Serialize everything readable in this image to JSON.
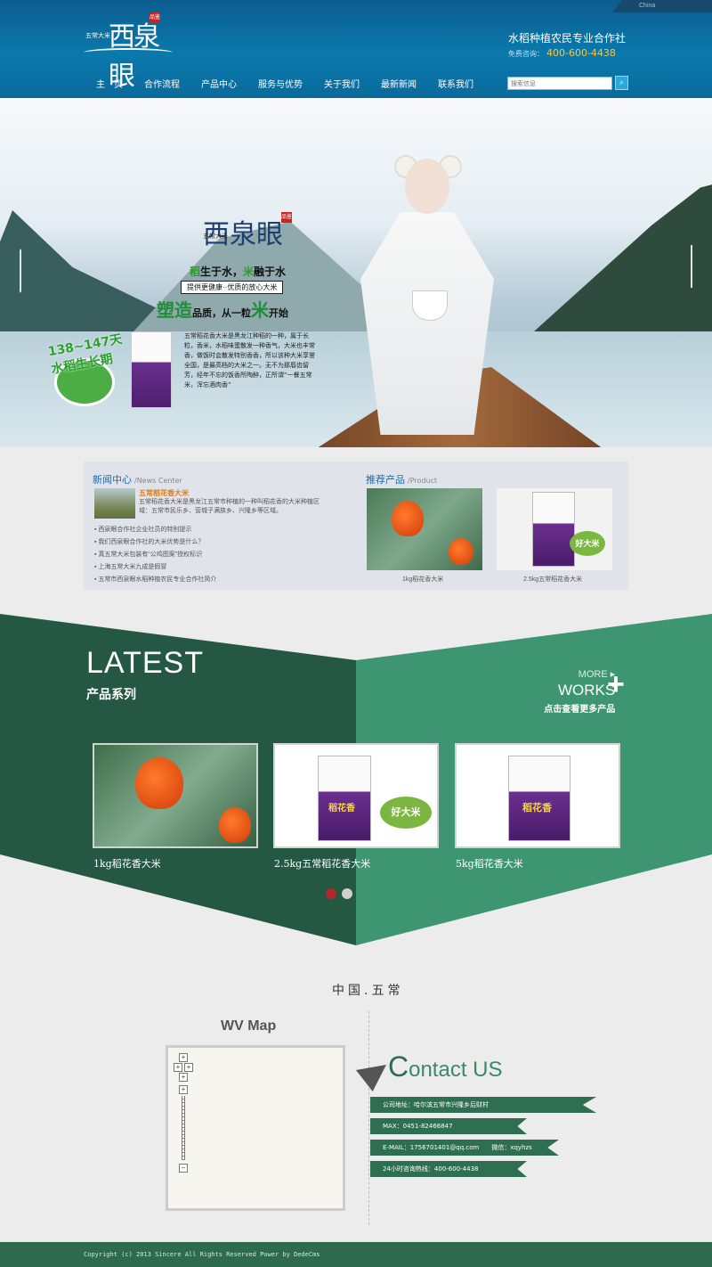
{
  "header": {
    "china_tag": "China",
    "logo_small": "五常大米",
    "logo_main": "西泉眼",
    "logo_seal": "品鉴",
    "coop_name": "水稻种植农民专业合作社",
    "hotline_label": "免费咨询：",
    "hotline_number": "400-600-4438",
    "nav": [
      "主　页",
      "合作流程",
      "产品中心",
      "服务与优势",
      "关于我们",
      "最新新闻",
      "联系我们"
    ],
    "search_placeholder": "搜索信息"
  },
  "banner": {
    "logo_small": "五常大米",
    "logo_main": "西泉眼",
    "logo_seal": "品鉴",
    "slogan1_a": "稻",
    "slogan1_b": "生于水，",
    "slogan1_c": "米",
    "slogan1_d": "融于水",
    "slogan2": "提供更健康··优质的放心大米",
    "slogan3_a": "塑造",
    "slogan3_b": "品质，从一粒",
    "slogan3_c": "米",
    "slogan3_d": "开始",
    "description": "五常稻花香大米是黑龙江种稻的一种，属于长粒，香米，水稻味蛋散发一种香气，大米也丰常香，做饭时会散发特别香香，所以该种大米享誉全国，是最高档的大米之一。无不为那唇齿留芳，经年不忘的饭香所陶醉，正所谓“一餐五常米，浑忘酒肉香”",
    "badge_text": "138~147天水稻生长期"
  },
  "news": {
    "title": "新闻中心",
    "title_en": "/News Center",
    "featured_title": "五常稻花香大米",
    "featured_desc": "五常稻花香大米是黑龙江五常市种植的一种叫稻花香的大米种植区域：五常市民乐乡、营城子满族乡、兴隆乡等区域。",
    "items": [
      "西泉眼合作社企业社员的特别提示",
      "我们西泉眼合作社的大米优势是什么？",
      "真五常大米包装有“公鸡图案”授权标识",
      "上海五常大米九成是假冒",
      "五常市西泉眼水稻种植农民专业合作社简介"
    ]
  },
  "recommend": {
    "title": "推荐产品",
    "title_en": "/Product",
    "products": [
      "1kg稻花香大米",
      "2.5kg五常稻花香大米"
    ],
    "bag_label": "好大米"
  },
  "latest": {
    "title": "LATEST",
    "subtitle": "产品系列",
    "more": "MORE",
    "works": "WORKS",
    "more_desc": "点击查看更多产品",
    "plus": "+",
    "products": [
      "1kg稻花香大米",
      "2.5kg五常稻花香大米",
      "5kg稻花香大米"
    ],
    "bag_brand": "稻花香",
    "bag_label": "好大米"
  },
  "contact": {
    "location": "中国.五常",
    "map_title": "WV Map",
    "contact_title_c": "C",
    "contact_title_rest": "ontact",
    "contact_title_us": "US",
    "address": "公司地址：哈尔滨五常市兴隆乡后财村",
    "fax": "MAX：0451-82466847",
    "email": "E-MAIL：1756701401@qq.com　　微信：xqyhzs",
    "hotline": "24小时咨询热线：400-600-4438"
  },
  "footer": {
    "copyright": "Copyright (c) 2013 Sincere All Rights Reserved Power by DedeCms"
  },
  "colors": {
    "header_blue": "#0a79ac",
    "dark_green": "#245843",
    "light_green": "#3d9671",
    "accent_orange": "#e07b16",
    "hotline_yellow": "#f5c84a"
  }
}
